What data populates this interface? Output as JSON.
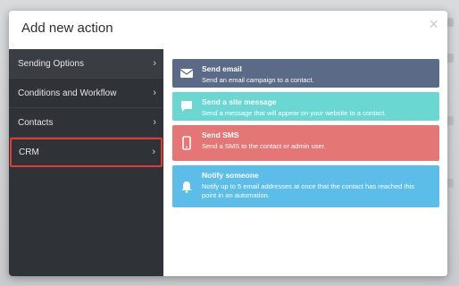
{
  "modal": {
    "title": "Add new action",
    "close_label": "×"
  },
  "sidebar": {
    "items": [
      {
        "label": "Sending Options",
        "chevron": "›"
      },
      {
        "label": "Conditions and Workflow",
        "chevron": "›"
      },
      {
        "label": "Contacts",
        "chevron": "›"
      },
      {
        "label": "CRM",
        "chevron": "›"
      }
    ]
  },
  "actions": [
    {
      "title": "Send email",
      "description": "Send an email campaign to a contact.",
      "icon": "envelope-icon",
      "color": "#5a6a87"
    },
    {
      "title": "Send a site message",
      "description": "Send a message that will appear on your website to a contact.",
      "icon": "chat-bubble-icon",
      "color": "#6ad7d3"
    },
    {
      "title": "Send SMS",
      "description": "Send a SMS to the contact or admin user.",
      "icon": "mobile-phone-icon",
      "color": "#e47676"
    },
    {
      "title": "Notify someone",
      "description": "Notify up to 5 email addresses at once that the contact has reached this point in an automation.",
      "icon": "bell-icon",
      "color": "#5cbde9"
    }
  ]
}
